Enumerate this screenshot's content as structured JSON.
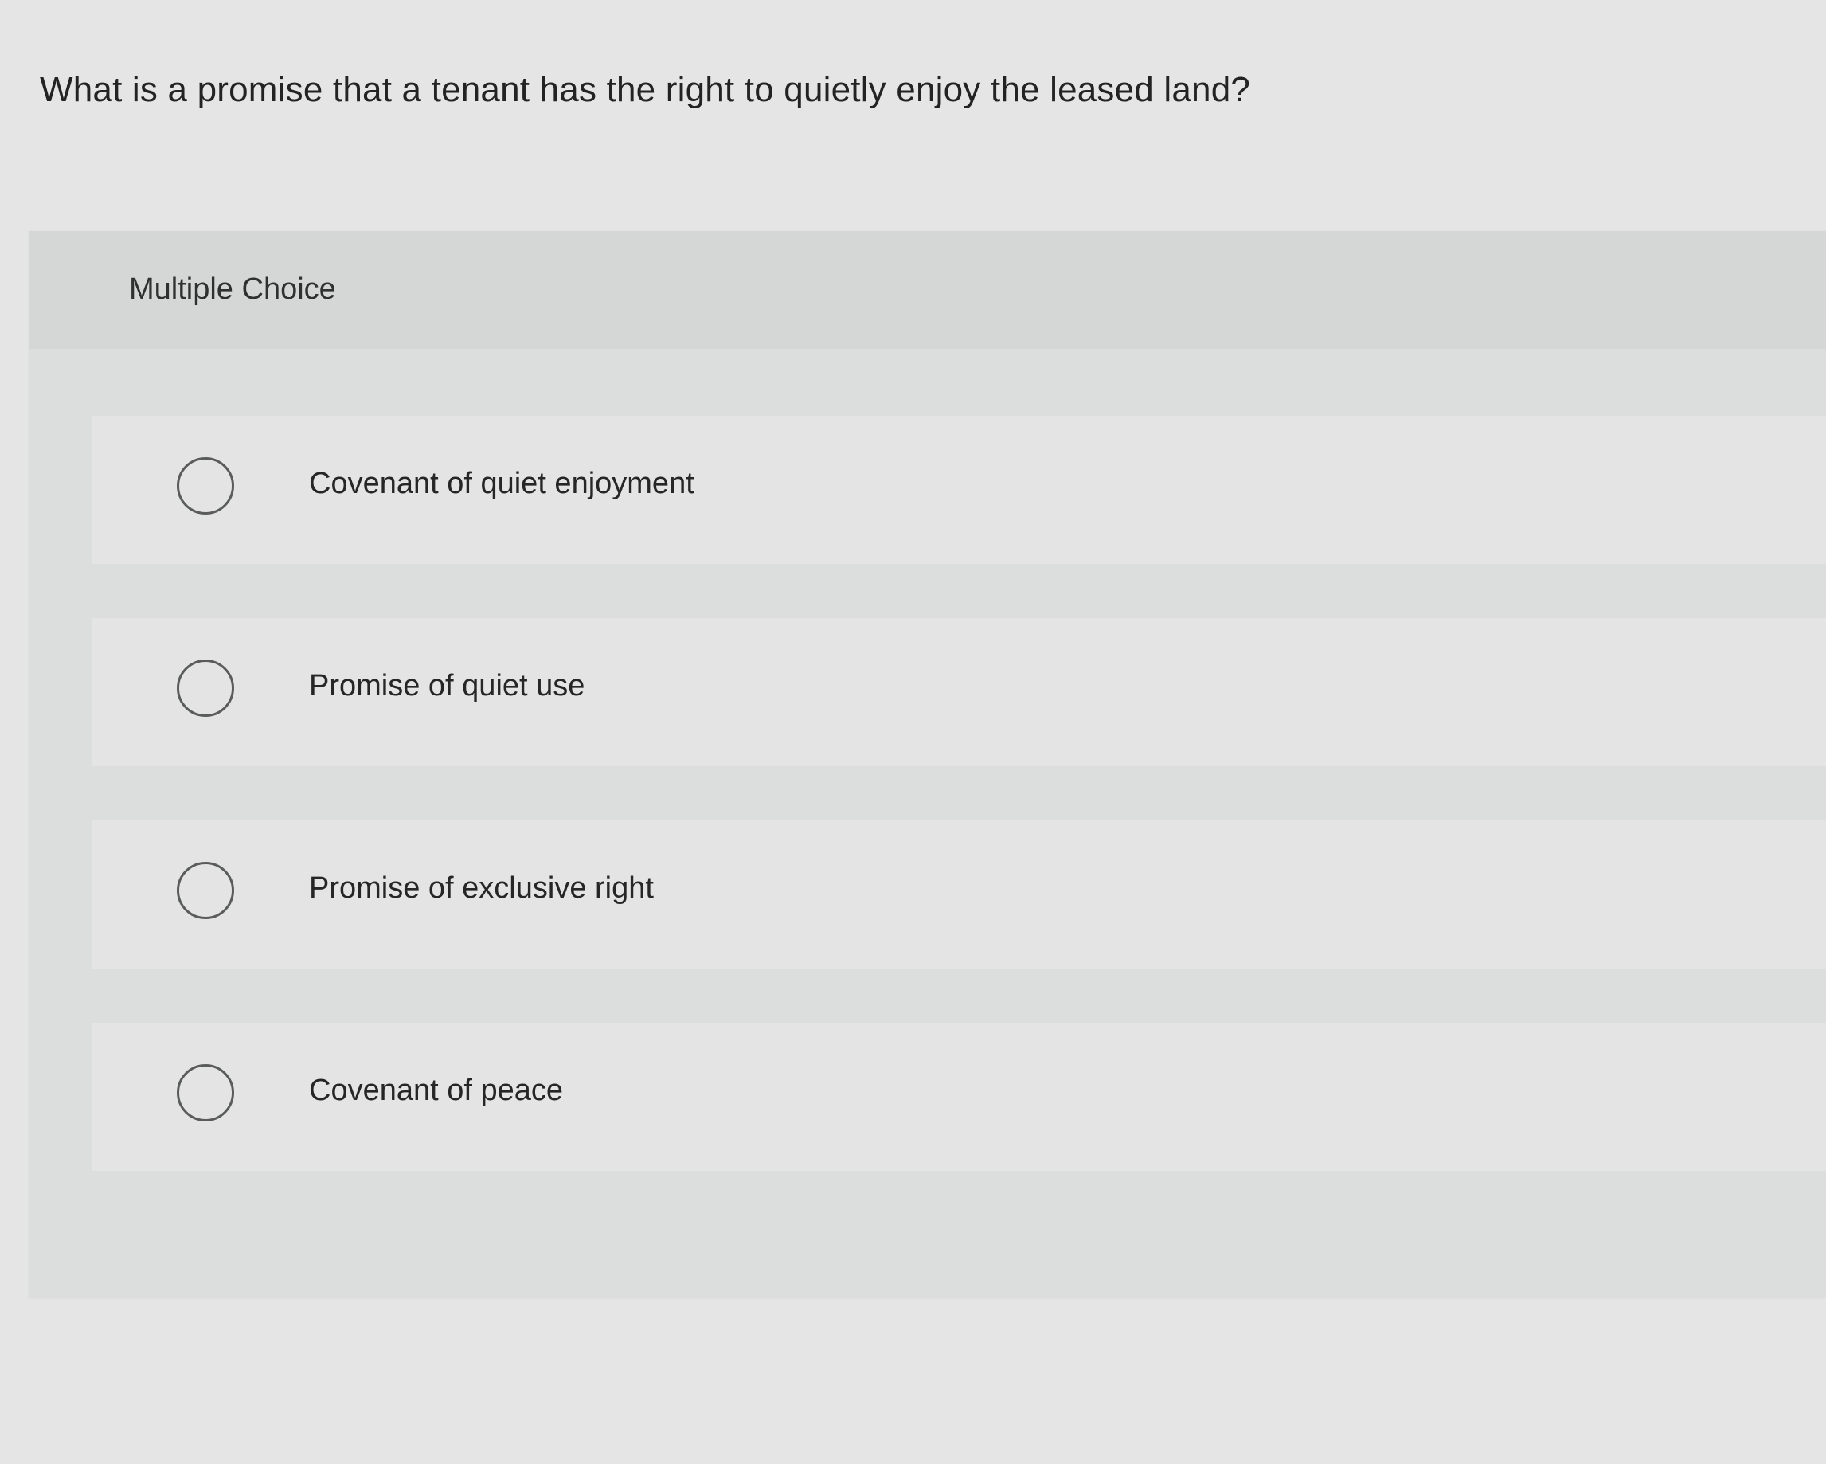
{
  "question": {
    "text": "What is a promise that a tenant has the right to quietly enjoy the leased land?"
  },
  "multiple_choice": {
    "label": "Multiple Choice",
    "options": [
      {
        "text": "Covenant of quiet enjoyment",
        "selected": false
      },
      {
        "text": "Promise of quiet use",
        "selected": false
      },
      {
        "text": "Promise of exclusive right",
        "selected": false
      },
      {
        "text": "Covenant of peace",
        "selected": false
      }
    ]
  }
}
